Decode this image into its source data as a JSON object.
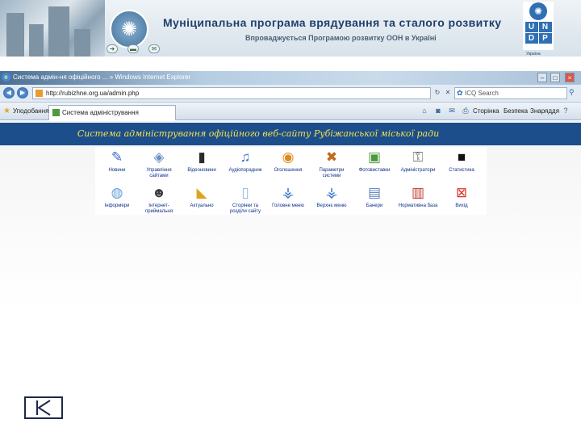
{
  "banner": {
    "title": "Муніципальна програма врядування та сталого розвитку",
    "subtitle": "Впроваджується Програмою розвитку ООН в Україні",
    "logo_letters": [
      "U",
      "N",
      "D",
      "P"
    ],
    "logo_caption": "Україна",
    "nav_icons": [
      "arrow-right-icon",
      "book-icon",
      "envelope-icon"
    ]
  },
  "browser": {
    "window_title": "Система адмін-ня офіційного ... » Windows Internet Explorer",
    "window_buttons": [
      "–",
      "□",
      "×"
    ],
    "address": "http://rubizhne.org.ua/admin.php",
    "search_placeholder": "ICQ Search",
    "favorites_label": "Уподобання",
    "tab_title": "Система адміністрування",
    "command_items": [
      "Сторінка",
      "Безпека",
      "Знаряддя"
    ]
  },
  "page": {
    "title": "Система адміністрування офіційного веб-сайту Рубіжанської міської ради",
    "modules_row1": [
      {
        "label": "Новини",
        "icon": "pen-icon"
      },
      {
        "label": "Управління сайтами",
        "icon": "cube-icon"
      },
      {
        "label": "Відеоновини",
        "icon": "video-phone-icon"
      },
      {
        "label": "Аудіопорадник",
        "icon": "audio-icon"
      },
      {
        "label": "Оголошення",
        "icon": "announcement-icon"
      },
      {
        "label": "Параметри системи",
        "icon": "tools-icon"
      },
      {
        "label": "Фотовиставки",
        "icon": "photo-icon"
      },
      {
        "label": "Адміністратори",
        "icon": "keys-icon"
      },
      {
        "label": "Статистика",
        "icon": "chart-icon"
      }
    ],
    "modules_row2": [
      {
        "label": "Інформери",
        "icon": "globe-icon"
      },
      {
        "label": "Інтернет-приймальня",
        "icon": "user-icon"
      },
      {
        "label": "Актуально",
        "icon": "pin-icon"
      },
      {
        "label": "Сторінки та розділи сайту",
        "icon": "document-icon"
      },
      {
        "label": "Головне меню",
        "icon": "tree-icon"
      },
      {
        "label": "Верхнє меню",
        "icon": "tree-icon"
      },
      {
        "label": "Банери",
        "icon": "banner-icon"
      },
      {
        "label": "Нормативна база",
        "icon": "book-icon"
      },
      {
        "label": "Вихід",
        "icon": "exit-icon"
      }
    ]
  },
  "slide": {
    "nav_button": "end-slide-icon"
  }
}
